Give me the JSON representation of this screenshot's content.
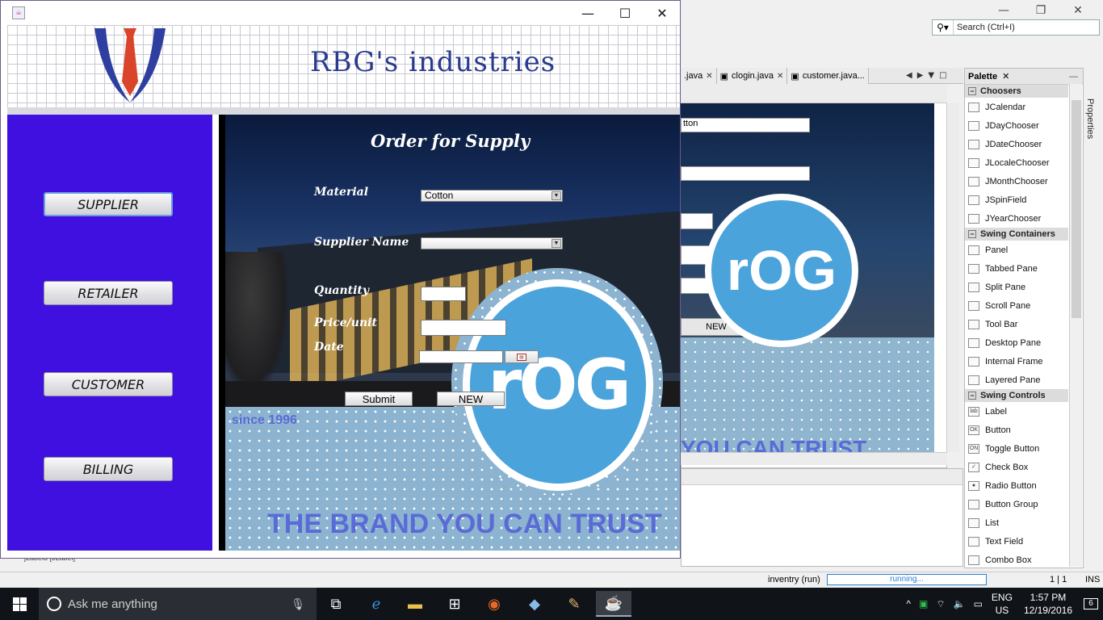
{
  "ide": {
    "search_placeholder": "Search (Ctrl+I)",
    "editor_tabs": [
      {
        "label": ".java"
      },
      {
        "label": "clogin.java"
      },
      {
        "label": "customer.java..."
      }
    ],
    "design_preview": {
      "combo_text": "tton",
      "new_button": "NEW",
      "tagline_fragment": "YOU CAN TRUST",
      "logo_text": "rOG"
    },
    "palette": {
      "title": "Palette",
      "categories": [
        {
          "name": "Choosers",
          "items": [
            "JCalendar",
            "JDayChooser",
            "JDateChooser",
            "JLocaleChooser",
            "JMonthChooser",
            "JSpinField",
            "JYearChooser"
          ]
        },
        {
          "name": "Swing Containers",
          "items": [
            "Panel",
            "Tabbed Pane",
            "Split Pane",
            "Scroll Pane",
            "Tool Bar",
            "Desktop Pane",
            "Internal Frame",
            "Layered Pane"
          ]
        },
        {
          "name": "Swing Controls",
          "items": [
            "Label",
            "Button",
            "Toggle Button",
            "Check Box",
            "Radio Button",
            "Button Group",
            "List",
            "Text Field",
            "Combo Box"
          ]
        }
      ]
    },
    "properties_tab": "Properties",
    "navigator_fragment": "jLabel3 [JLabel]",
    "status": {
      "project": "inventry (run)",
      "progress_text": "running...",
      "position": "1 | 1",
      "mode": "INS"
    }
  },
  "app": {
    "company_title": "RBG's industries",
    "sidebar": [
      {
        "label": "SUPPLIER"
      },
      {
        "label": "RETAILER"
      },
      {
        "label": "CUSTOMER"
      },
      {
        "label": "BILLING"
      }
    ],
    "form": {
      "title": "Order for Supply",
      "material_label": "Material",
      "material_value": "Cotton",
      "supplier_label": "Supplier Name",
      "supplier_value": "",
      "quantity_label": "Quantity",
      "quantity_value": "",
      "price_label": "Price/unit",
      "price_value": "",
      "date_label": "Date",
      "date_value": "",
      "submit_label": "Submit",
      "new_label": "NEW"
    },
    "since": "since 1996",
    "tagline": "THE BRAND YOU CAN TRUST",
    "logo_text": "rOG",
    "colors": {
      "sidebar": "#4010e0",
      "title": "#2a3a8f",
      "logo_blue": "#4ba3dc",
      "tagline": "#5a6bd6"
    }
  },
  "taskbar": {
    "search_text": "Ask me anything",
    "language_top": "ENG",
    "language_bottom": "US",
    "time": "1:57 PM",
    "date": "12/19/2016",
    "notification_count": "6"
  }
}
